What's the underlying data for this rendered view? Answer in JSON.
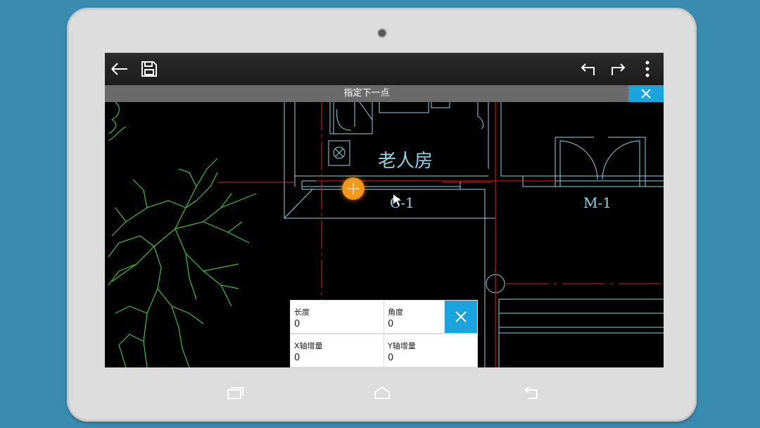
{
  "toolbar": {
    "back_icon": "arrow-left-icon",
    "save_icon": "save-icon",
    "undo_icon": "undo-icon",
    "redo_icon": "redo-icon",
    "more_icon": "more-vertical-icon"
  },
  "prompt": {
    "text": "指定下一点",
    "close_icon": "close-icon"
  },
  "drawing": {
    "room_label": "老人房",
    "window_label": "C-1",
    "door_label": "M-1"
  },
  "input_panel": {
    "length_label": "长度",
    "length_value": "0",
    "angle_label": "角度",
    "angle_value": "0",
    "x_increment_label": "X轴增量",
    "x_increment_value": "0",
    "y_increment_label": "Y轴增量",
    "y_increment_value": "0"
  },
  "colors": {
    "accent": "#1aa3dc",
    "cursor": "#f39a1e",
    "cad_line": "#8fd3e6",
    "cad_axis": "#e02020",
    "tree": "#3fc03f"
  }
}
